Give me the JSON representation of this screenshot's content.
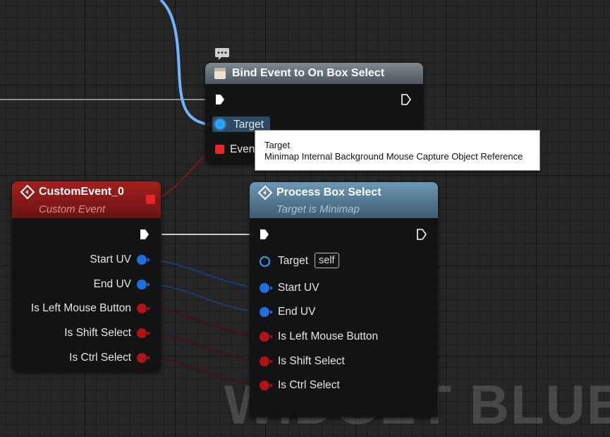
{
  "watermark": "WIDGET BLUEPR",
  "bind_node": {
    "title": "Bind Event to On Box Select",
    "pins": {
      "target": "Target",
      "event": "Event"
    }
  },
  "tooltip": {
    "title": "Target",
    "description": "Minimap Internal Background Mouse Capture Object Reference"
  },
  "custom_event_node": {
    "title": "CustomEvent_0",
    "subtitle": "Custom Event",
    "pins": [
      "Start UV",
      "End UV",
      "Is Left Mouse Button",
      "Is Shift Select",
      "Is Ctrl Select"
    ]
  },
  "process_node": {
    "title": "Process Box Select",
    "subtitle": "Target is Minimap",
    "target_label": "Target",
    "target_default": "self",
    "pins": [
      "Start UV",
      "End UV",
      "Is Left Mouse Button",
      "Is Shift Select",
      "Is Ctrl Select"
    ]
  },
  "icons": {
    "comment": "comment-bubble-icon",
    "bind_node": "function-box-icon",
    "event_node": "event-diamond-icon",
    "exec": "exec-arrow-icon"
  },
  "colors": {
    "float_wire": "#6fb4ff",
    "vector_pin": "#1f6fe0",
    "bool_pin": "#b01414",
    "event_header": "#9c1c1c",
    "process_header": "#5e8aa8"
  }
}
